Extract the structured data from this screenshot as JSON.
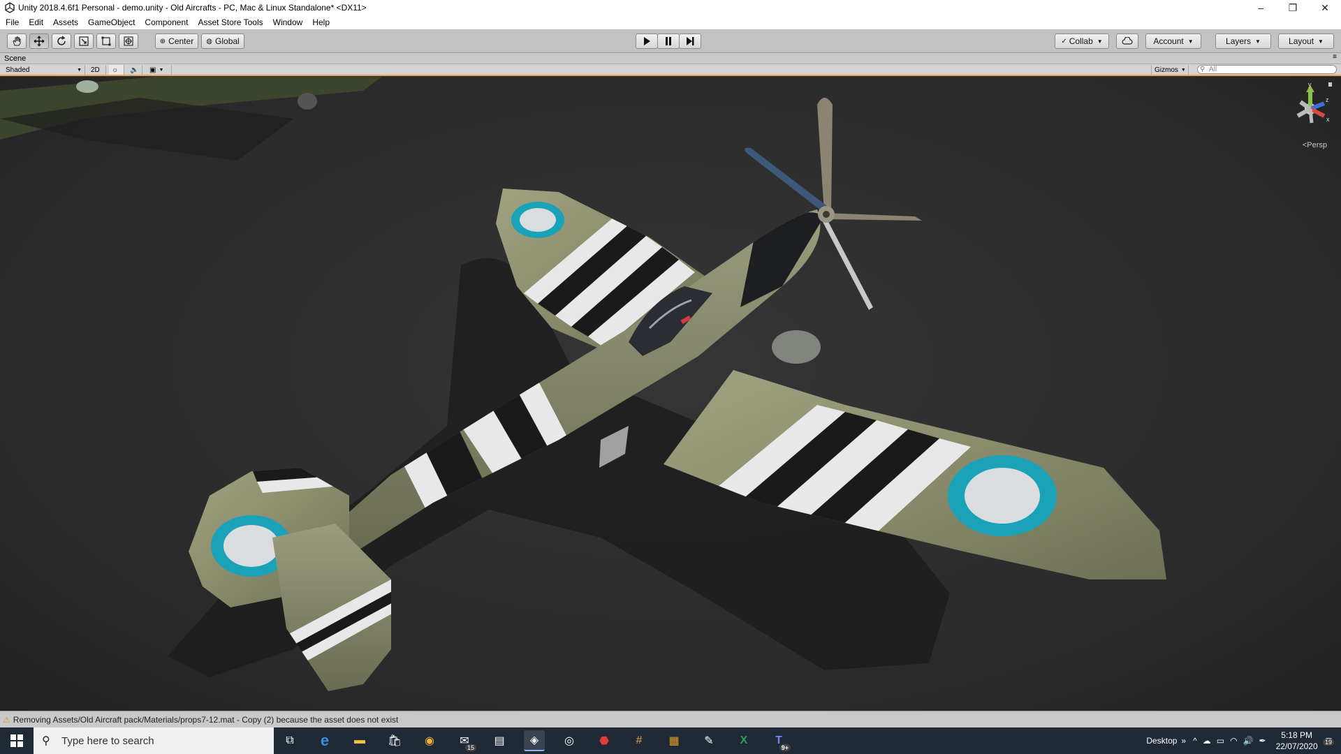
{
  "window": {
    "title": "Unity 2018.4.6f1 Personal - demo.unity - Old Aircrafts - PC, Mac & Linux Standalone* <DX11>",
    "controls": [
      "–",
      "❐",
      "✕"
    ]
  },
  "menu": [
    "File",
    "Edit",
    "Assets",
    "GameObject",
    "Component",
    "Asset Store Tools",
    "Window",
    "Help"
  ],
  "toolbar": {
    "tools": [
      "hand-tool",
      "move-tool",
      "rotate-tool",
      "scale-tool",
      "rect-tool",
      "transform-tool"
    ],
    "pivot": "Center",
    "space": "Global",
    "play": "▶",
    "pause": "❚❚",
    "step": "▶❚",
    "collab": "Collab",
    "account": "Account",
    "layers": "Layers",
    "layout": "Layout"
  },
  "scene_tab": {
    "label": "Scene"
  },
  "scene_bar": {
    "draw_mode": "Shaded",
    "mode_2d": "2D",
    "gizmos": "Gizmos",
    "search_placeholder": "All"
  },
  "viewport": {
    "axis_y": "y",
    "axis_z": "z",
    "axis_x": "x",
    "projection": "<Persp"
  },
  "status": {
    "message": "Removing Assets/Old Aircraft pack/Materials/props7-12.mat - Copy (2) because the asset does not exist"
  },
  "taskbar": {
    "search_placeholder": "Type here to search",
    "mail_badge": "15",
    "teams_badge": "9+",
    "desktop_label": "Desktop",
    "time": "5:18 PM",
    "date": "22/07/2020",
    "notifications": "19"
  },
  "colors": {
    "toolbar": "#c2c2c2",
    "viewport": "#2e2e2e",
    "olive": "#8a8a68",
    "roundel_blue": "#1aa3b8",
    "scene_accent": "#e8a056"
  }
}
